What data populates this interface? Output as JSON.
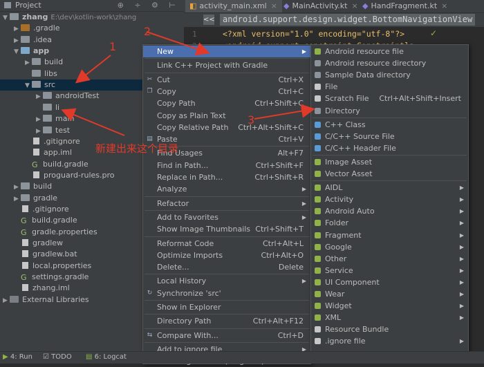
{
  "project": {
    "header_title": "Project",
    "header_icons": "⊕ ÷ ⚙ ⊢",
    "tree": [
      {
        "label": "zhang",
        "hint": "E:\\dev\\kotlin-work\\zhang",
        "arrow": "▼",
        "icon": "folder",
        "indent": 0,
        "bold": true
      },
      {
        "label": ".gradle",
        "arrow": "▶",
        "icon": "folder-orange",
        "indent": 1
      },
      {
        "label": ".idea",
        "arrow": "▶",
        "icon": "folder",
        "indent": 1
      },
      {
        "label": "app",
        "arrow": "▼",
        "icon": "folder-blue",
        "indent": 1,
        "bold": true
      },
      {
        "label": "build",
        "arrow": "▶",
        "icon": "folder",
        "indent": 2
      },
      {
        "label": "libs",
        "arrow": "",
        "icon": "folder",
        "indent": 2
      },
      {
        "label": "src",
        "arrow": "▼",
        "icon": "folder",
        "indent": 2,
        "selected": true
      },
      {
        "label": "androidTest",
        "arrow": "▶",
        "icon": "folder",
        "indent": 3
      },
      {
        "label": "li",
        "arrow": "",
        "icon": "folder",
        "indent": 3
      },
      {
        "label": "main",
        "arrow": "▶",
        "icon": "folder",
        "indent": 3
      },
      {
        "label": "test",
        "arrow": "▶",
        "icon": "folder",
        "indent": 3
      },
      {
        "label": ".gitignore",
        "arrow": "",
        "icon": "file",
        "indent": 2
      },
      {
        "label": "app.iml",
        "arrow": "",
        "icon": "file",
        "indent": 2
      },
      {
        "label": "build.gradle",
        "arrow": "",
        "icon": "gradle",
        "indent": 2
      },
      {
        "label": "proguard-rules.pro",
        "arrow": "",
        "icon": "file",
        "indent": 2
      },
      {
        "label": "build",
        "arrow": "▶",
        "icon": "folder",
        "indent": 1
      },
      {
        "label": "gradle",
        "arrow": "▶",
        "icon": "folder",
        "indent": 1
      },
      {
        "label": ".gitignore",
        "arrow": "",
        "icon": "file",
        "indent": 1
      },
      {
        "label": "build.gradle",
        "arrow": "",
        "icon": "gradle",
        "indent": 1
      },
      {
        "label": "gradle.properties",
        "arrow": "",
        "icon": "gradle",
        "indent": 1
      },
      {
        "label": "gradlew",
        "arrow": "",
        "icon": "file",
        "indent": 1
      },
      {
        "label": "gradlew.bat",
        "arrow": "",
        "icon": "file",
        "indent": 1
      },
      {
        "label": "local.properties",
        "arrow": "",
        "icon": "file",
        "indent": 1
      },
      {
        "label": "settings.gradle",
        "arrow": "",
        "icon": "gradle",
        "indent": 1
      },
      {
        "label": "zhang.iml",
        "arrow": "",
        "icon": "file",
        "indent": 1
      },
      {
        "label": "External Libraries",
        "arrow": "▶",
        "icon": "lib",
        "indent": 0
      }
    ]
  },
  "editor": {
    "tabs": [
      "activity_main.xml",
      "MainActivity.kt",
      "HandFragment.kt"
    ],
    "breadcrumb_chevron": "<<",
    "breadcrumb": "android.support.design.widget.BottomNavigationView",
    "lines": [
      {
        "num": "1",
        "text": "<?xml version=\"1.0\" encoding=\"utf-8\"?>"
      },
      {
        "num": "2",
        "text": "<android.support.constraint.Constraintla"
      }
    ]
  },
  "context_menu": [
    {
      "label": "New",
      "shortcut": "",
      "submenu": true,
      "highlight": true,
      "icon": ""
    },
    {
      "sep": true
    },
    {
      "label": "Link C++ Project with Gradle",
      "shortcut": "",
      "icon": ""
    },
    {
      "sep": true
    },
    {
      "label": "Cut",
      "shortcut": "Ctrl+X",
      "icon": "cut-icon",
      "glyph": "✂"
    },
    {
      "label": "Copy",
      "shortcut": "Ctrl+C",
      "icon": "copy-icon",
      "glyph": "❐"
    },
    {
      "label": "Copy Path",
      "shortcut": "Ctrl+Shift+C",
      "icon": ""
    },
    {
      "label": "Copy as Plain Text",
      "shortcut": "",
      "icon": ""
    },
    {
      "label": "Copy Relative Path",
      "shortcut": "Ctrl+Alt+Shift+C",
      "icon": ""
    },
    {
      "label": "Paste",
      "shortcut": "Ctrl+V",
      "icon": "paste-icon",
      "glyph": "▤"
    },
    {
      "sep": true
    },
    {
      "label": "Find Usages",
      "shortcut": "Alt+F7",
      "icon": ""
    },
    {
      "label": "Find in Path...",
      "shortcut": "Ctrl+Shift+F",
      "icon": ""
    },
    {
      "label": "Replace in Path...",
      "shortcut": "Ctrl+Shift+R",
      "icon": ""
    },
    {
      "label": "Analyze",
      "shortcut": "",
      "submenu": true,
      "icon": ""
    },
    {
      "sep": true
    },
    {
      "label": "Refactor",
      "shortcut": "",
      "submenu": true,
      "icon": ""
    },
    {
      "sep": true
    },
    {
      "label": "Add to Favorites",
      "shortcut": "",
      "submenu": true,
      "icon": ""
    },
    {
      "label": "Show Image Thumbnails",
      "shortcut": "Ctrl+Shift+T",
      "icon": ""
    },
    {
      "sep": true
    },
    {
      "label": "Reformat Code",
      "shortcut": "Ctrl+Alt+L",
      "icon": ""
    },
    {
      "label": "Optimize Imports",
      "shortcut": "Ctrl+Alt+O",
      "icon": ""
    },
    {
      "label": "Delete...",
      "shortcut": "Delete",
      "icon": ""
    },
    {
      "sep": true
    },
    {
      "label": "Local History",
      "shortcut": "",
      "submenu": true,
      "icon": ""
    },
    {
      "label": "Synchronize 'src'",
      "shortcut": "",
      "icon": "sync-icon",
      "glyph": "↻"
    },
    {
      "sep": true
    },
    {
      "label": "Show in Explorer",
      "shortcut": "",
      "icon": ""
    },
    {
      "sep": true
    },
    {
      "label": "Directory Path",
      "shortcut": "Ctrl+Alt+F12",
      "icon": ""
    },
    {
      "sep": true
    },
    {
      "label": "Compare With...",
      "shortcut": "Ctrl+D",
      "icon": "compare-icon",
      "glyph": "⇆"
    },
    {
      "sep": true
    },
    {
      "label": "Add to ignore file",
      "shortcut": "",
      "submenu": true,
      "icon": ""
    },
    {
      "label": "Add to ignore file (unignore)",
      "shortcut": "",
      "submenu": true,
      "icon": ""
    }
  ],
  "new_submenu": [
    {
      "label": "Android resource file",
      "icon": "android-file-icon",
      "color": "#8fb24a",
      "shortcut": ""
    },
    {
      "label": "Android resource directory",
      "icon": "folder-icon",
      "color": "#8c939a",
      "shortcut": ""
    },
    {
      "label": "Sample Data directory",
      "icon": "folder-icon",
      "color": "#8c939a",
      "shortcut": ""
    },
    {
      "label": "File",
      "icon": "file-icon",
      "color": "#c7c7c7",
      "shortcut": ""
    },
    {
      "label": "Scratch File",
      "icon": "scratch-icon",
      "color": "#c7c7c7",
      "shortcut": "Ctrl+Alt+Shift+Insert"
    },
    {
      "label": "Directory",
      "icon": "folder-icon",
      "color": "#8c939a",
      "shortcut": ""
    },
    {
      "sep": true
    },
    {
      "label": "C++ Class",
      "icon": "cpp-class-icon",
      "color": "#5a9bd5",
      "shortcut": ""
    },
    {
      "label": "C/C++ Source File",
      "icon": "cpp-source-icon",
      "color": "#5a9bd5",
      "shortcut": ""
    },
    {
      "label": "C/C++ Header File",
      "icon": "cpp-header-icon",
      "color": "#5a9bd5",
      "shortcut": ""
    },
    {
      "sep": true
    },
    {
      "label": "Image Asset",
      "icon": "android-icon",
      "color": "#8fb24a",
      "shortcut": ""
    },
    {
      "label": "Vector Asset",
      "icon": "android-icon",
      "color": "#8fb24a",
      "shortcut": ""
    },
    {
      "sep": true
    },
    {
      "label": "AIDL",
      "icon": "android-icon",
      "color": "#8fb24a",
      "submenu": true
    },
    {
      "label": "Activity",
      "icon": "android-icon",
      "color": "#8fb24a",
      "submenu": true
    },
    {
      "label": "Android Auto",
      "icon": "android-icon",
      "color": "#8fb24a",
      "submenu": true
    },
    {
      "label": "Folder",
      "icon": "android-icon",
      "color": "#8fb24a",
      "submenu": true
    },
    {
      "label": "Fragment",
      "icon": "android-icon",
      "color": "#8fb24a",
      "submenu": true
    },
    {
      "label": "Google",
      "icon": "android-icon",
      "color": "#8fb24a",
      "submenu": true
    },
    {
      "label": "Other",
      "icon": "android-icon",
      "color": "#8fb24a",
      "submenu": true
    },
    {
      "label": "Service",
      "icon": "android-icon",
      "color": "#8fb24a",
      "submenu": true
    },
    {
      "label": "UI Component",
      "icon": "android-icon",
      "color": "#8fb24a",
      "submenu": true
    },
    {
      "label": "Wear",
      "icon": "android-icon",
      "color": "#8fb24a",
      "submenu": true
    },
    {
      "label": "Widget",
      "icon": "android-icon",
      "color": "#8fb24a",
      "submenu": true
    },
    {
      "label": "XML",
      "icon": "android-icon",
      "color": "#8fb24a",
      "submenu": true
    },
    {
      "label": "Resource Bundle",
      "icon": "bundle-icon",
      "color": "#c7c7c7",
      "shortcut": ""
    },
    {
      "label": ".ignore file",
      "icon": "ignore-icon",
      "color": "#c7c7c7",
      "submenu": true
    }
  ],
  "annotations": {
    "n1": "1",
    "n2": "2",
    "n3": "3",
    "note": "新建出来这个目录",
    "color": "#e23a2a"
  },
  "bottom_tabs": [
    "4: Run",
    "TODO",
    "6: Logcat"
  ]
}
